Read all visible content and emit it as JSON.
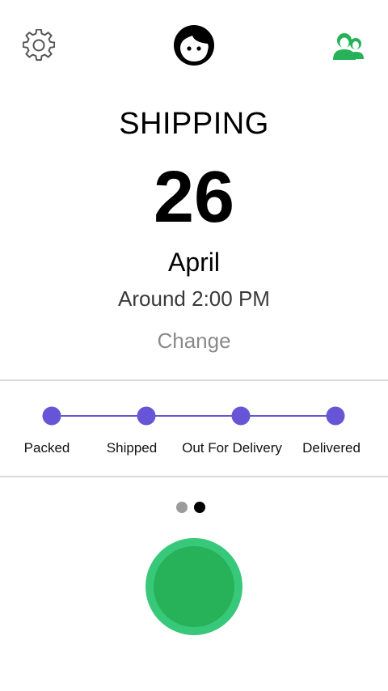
{
  "header": {
    "settings_icon": "gear-icon",
    "avatar_icon": "face-avatar-icon",
    "contacts_icon": "people-icon",
    "accent": "#27b259"
  },
  "shipping": {
    "title": "SHIPPING",
    "day": "26",
    "month": "April",
    "time": "Around 2:00 PM",
    "change_label": "Change"
  },
  "progress": {
    "color": "#6655d6",
    "steps": [
      {
        "label": "Packed"
      },
      {
        "label": "Shipped"
      },
      {
        "label": "Out For Delivery"
      },
      {
        "label": "Delivered"
      }
    ]
  },
  "pager": {
    "pages": 2,
    "current": 2
  },
  "action_button": {
    "outer_color": "#38c87a",
    "inner_color": "#27b259"
  }
}
